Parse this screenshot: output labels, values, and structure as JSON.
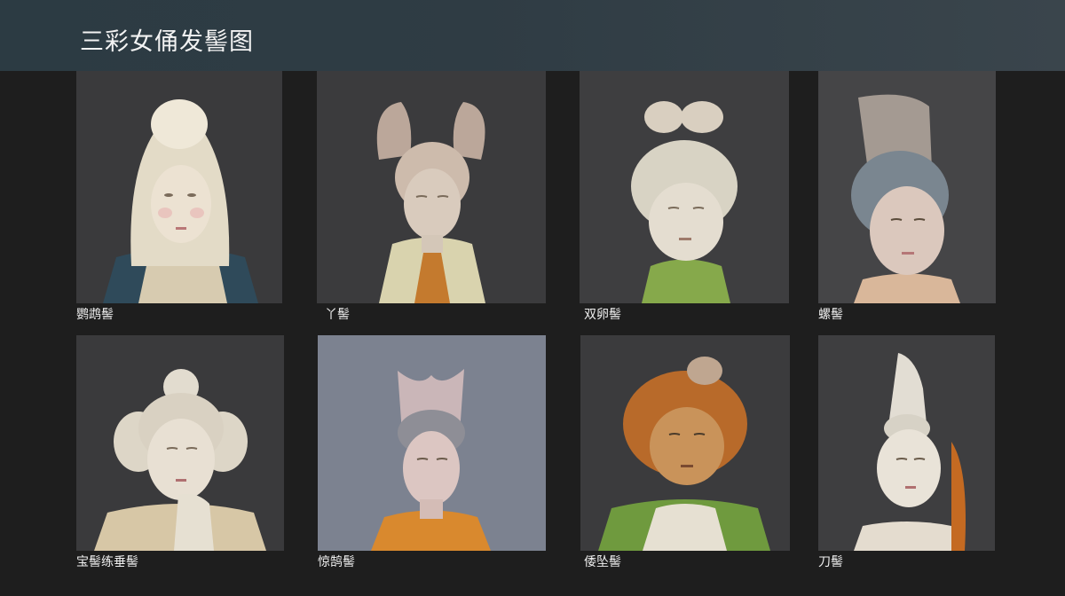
{
  "page": {
    "title": "三彩女俑发髻图"
  },
  "figures": [
    {
      "caption": "鹦鹉髻",
      "image": "sancai-figurine-parrot-bun",
      "bg": "#3a3a3c"
    },
    {
      "caption": "丫髻",
      "image": "sancai-figurine-twin-forked-bun",
      "bg": "#3b3b3d"
    },
    {
      "caption": "双卵髻",
      "image": "sancai-figurine-double-egg-bun",
      "bg": "#3e3e40"
    },
    {
      "caption": "螺髻",
      "image": "sancai-figurine-spiral-bun",
      "bg": "#454547"
    },
    {
      "caption": "宝髻练垂髻",
      "image": "sancai-figurine-jeweled-hanging-bun",
      "bg": "#3a3a3c"
    },
    {
      "caption": "惊鹄髻",
      "image": "sancai-figurine-startled-swan-bun",
      "bg": "#7c8290"
    },
    {
      "caption": "倭坠髻",
      "image": "sancai-figurine-drooping-bun",
      "bg": "#3b3b3d"
    },
    {
      "caption": "刀髻",
      "image": "sancai-figurine-knife-bun",
      "bg": "#3e3e40"
    }
  ]
}
